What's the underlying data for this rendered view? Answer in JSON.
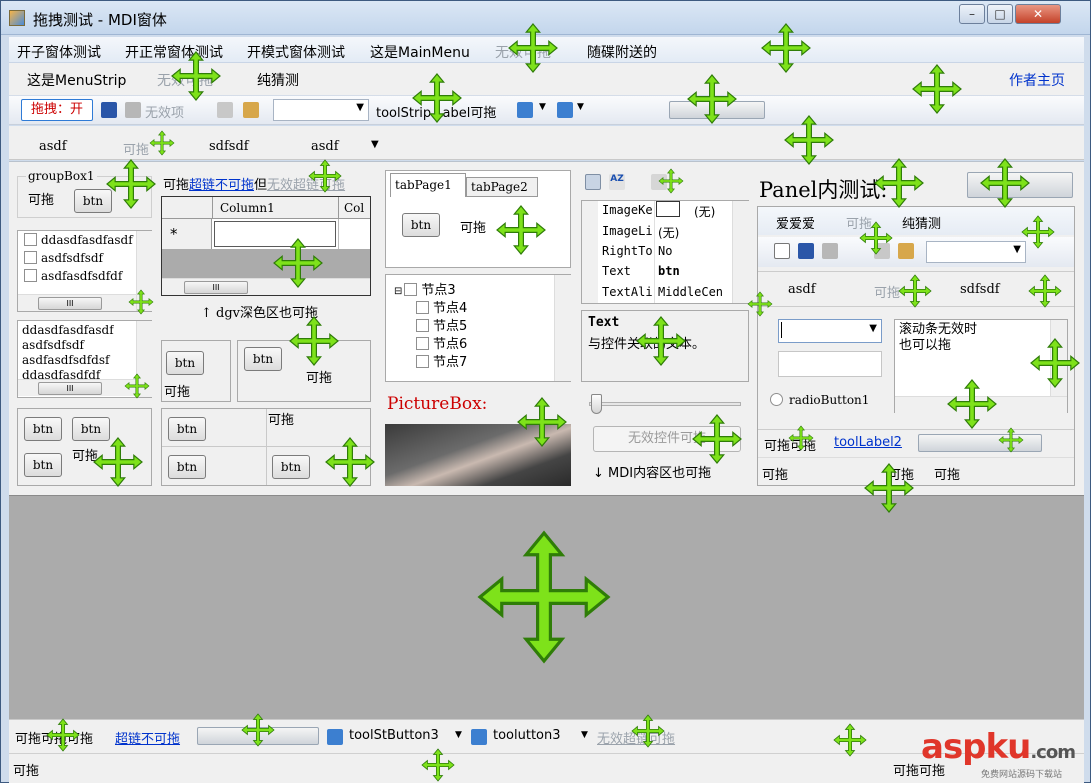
{
  "window": {
    "title": "拖拽测试 - MDI窗体",
    "min": "–",
    "max": "□",
    "close": "✕"
  },
  "menu": {
    "items": [
      "开子窗体测试",
      "开正常窗体测试",
      "开模式窗体测试",
      "这是MainMenu",
      "无效可拖",
      "随碟附送的"
    ]
  },
  "menustrip": {
    "items": [
      "这是MenuStrip",
      "无效可拖",
      "纯猜测"
    ],
    "right_link": "作者主页"
  },
  "toolbar": {
    "drag_toggle": "拖拽：开",
    "disabled_item": "无效项",
    "combo_value": "",
    "label": "toolStrip Label可拖"
  },
  "tabstrip": {
    "items": [
      "asdf",
      "可拖",
      "sdfsdf",
      "asdf"
    ]
  },
  "left": {
    "groupbox_title": "groupBox1",
    "group_label": "可拖",
    "btn": "btn",
    "checklist": [
      "ddasdfasdfasdf",
      "asdfsdfsdf",
      "asdfasdfsdfdf"
    ],
    "listbox": [
      "ddasdfasdfasdf",
      "asdfsdfsdf",
      "asdfasdfsdfdsf",
      "ddasdfasdfdf"
    ],
    "draggable": "可拖",
    "scroll_thumb": "III"
  },
  "mid": {
    "link_prefix": "可拖",
    "link_text": "超链不可拖",
    "link_mid": "但",
    "link_disabled": "无效超链可拖",
    "grid_columns": [
      "Column1",
      "Col"
    ],
    "grid_newrow": "*",
    "grid_caption": "↑ dgv深色区也可拖",
    "drag": "可拖"
  },
  "tabs": {
    "tab1": "tabPage1",
    "tab2": "tabPage2",
    "drag": "可拖",
    "tree_root": "节点3",
    "tree_children": [
      "节点4",
      "节点5",
      "节点6",
      "节点7"
    ],
    "picturebox": "PictureBox:"
  },
  "props": {
    "rows": [
      {
        "name": "ImageKe",
        "value": "(无)"
      },
      {
        "name": "ImageLi",
        "value": "(无)"
      },
      {
        "name": "RightTo",
        "value": "No"
      },
      {
        "name": "Text",
        "value": "btn"
      },
      {
        "name": "TextAli",
        "value": "MiddleCen"
      }
    ],
    "desc_title": "Text",
    "desc_body": "与控件关联的文本。",
    "disabled_button": "无效控件可拖",
    "mdi_note": "↓ MDI内容区也可拖"
  },
  "panel": {
    "title": "Panel内测试:",
    "menu_items": [
      "爱爱爱",
      "可拖",
      "纯猜测"
    ],
    "tabs": [
      "asdf",
      "可拖",
      "sdfsdf"
    ],
    "textarea": "滚动条无效时\n也可以拖",
    "radio": "radioButton1",
    "status_label": "可拖可拖",
    "status_link": "toolLabel2",
    "status_cells": [
      "可拖",
      "可拖",
      "可拖"
    ]
  },
  "bottom": {
    "label": "可拖可拖可拖",
    "link": "超链不可拖",
    "split1": "toolStButton3",
    "split2": "toolutton3",
    "disabled_link": "无效超链可拖"
  },
  "status": {
    "left": "可拖",
    "right": "可拖可拖"
  },
  "watermark": {
    "brand": "aspku",
    "suffix": ".com",
    "sub": "免费网站源码下载站"
  },
  "colors": {
    "drag_arrow": "#7ee21a",
    "link": "#0033cc",
    "pane": "#ababab",
    "title_red": "#cc0000"
  }
}
